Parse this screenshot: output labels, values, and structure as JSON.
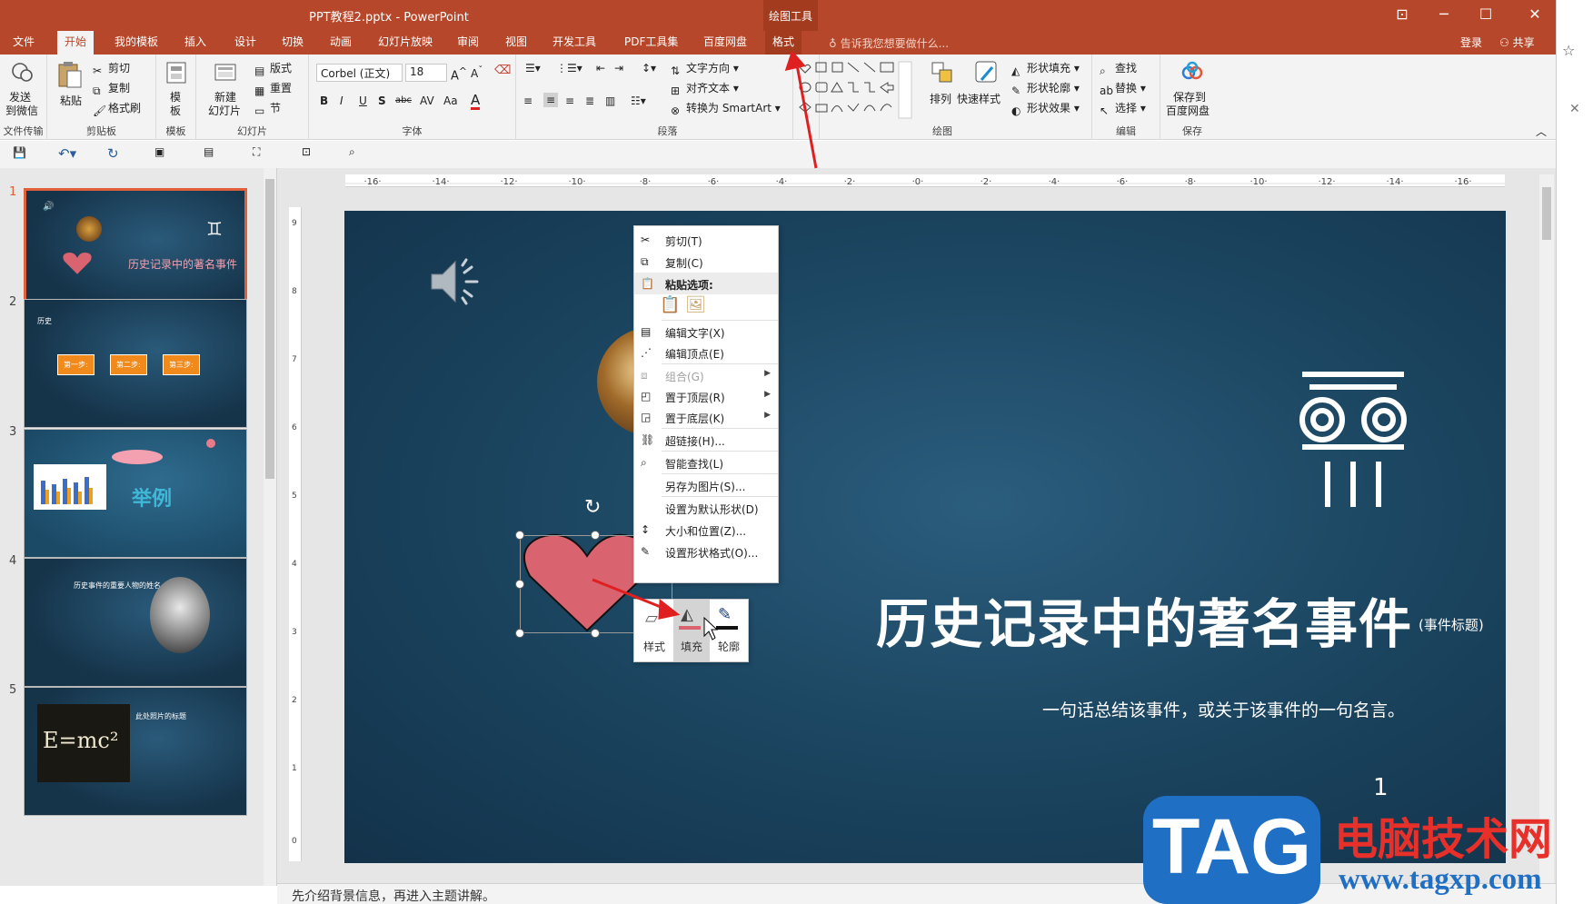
{
  "window": {
    "title": "PPT教程2.pptx - PowerPoint",
    "context_tool": "绘图工具",
    "controls": [
      "⊡",
      "─",
      "☐",
      "✕"
    ]
  },
  "tabs": [
    "文件",
    "开始",
    "我的模板",
    "插入",
    "设计",
    "切换",
    "动画",
    "幻灯片放映",
    "审阅",
    "视图",
    "开发工具",
    "PDF工具集",
    "百度网盘",
    "格式"
  ],
  "active_tab": "开始",
  "tell_me": "告诉我您想要做什么...",
  "account": {
    "login": "登录",
    "share": "共享"
  },
  "ribbon": {
    "send": {
      "label1": "发送",
      "label2": "到微信",
      "group": "文件传输"
    },
    "clipboard": {
      "paste": "粘贴",
      "cut": "剪切",
      "copy": "复制",
      "format_painter": "格式刷",
      "group": "剪贴板"
    },
    "template": {
      "label1": "模",
      "label2": "板",
      "group": "模板"
    },
    "slides": {
      "new1": "新建",
      "new2": "幻灯片",
      "layout": "版式",
      "reset": "重置",
      "section": "节",
      "group": "幻灯片"
    },
    "font": {
      "name": "Corbel (正文)",
      "size": "18",
      "group": "字体"
    },
    "paragraph": {
      "text_direction": "文字方向",
      "align_text": "对齐文本",
      "smartart": "转换为 SmartArt",
      "group": "段落"
    },
    "drawing": {
      "arrange": "排列",
      "quick_styles": "快速样式",
      "fill": "形状填充",
      "outline": "形状轮廓",
      "effects": "形状效果",
      "group": "绘图"
    },
    "editing": {
      "find": "查找",
      "replace": "替换",
      "select": "选择",
      "group": "编辑"
    },
    "save": {
      "label1": "保存到",
      "label2": "百度网盘",
      "group": "保存"
    }
  },
  "thumbnails": [
    {
      "num": "1",
      "title": "历史记录中的著名事件"
    },
    {
      "num": "2",
      "title": "历史",
      "steps": [
        "第一步:",
        "第二步:",
        "第三步:"
      ]
    },
    {
      "num": "3",
      "title": "举例"
    },
    {
      "num": "4",
      "title": "历史事件的重要人物的姓名"
    },
    {
      "num": "5",
      "title": "此处照片的标题"
    }
  ],
  "slide": {
    "title": "历史记录中的著名事件",
    "title_note": "(事件标题)",
    "quote": "一句话总结该事件，或关于该事件的一句名言。",
    "number": "1",
    "heart_color": "#d9636e"
  },
  "context_menu": {
    "items": [
      {
        "label": "剪切(T)",
        "icon": "scissors-icon",
        "enabled": true
      },
      {
        "label": "复制(C)",
        "icon": "copy-icon",
        "enabled": true
      },
      {
        "label": "粘贴选项:",
        "icon": "paste-icon",
        "enabled": true,
        "header": true
      },
      {
        "label": "编辑文字(X)",
        "icon": "edit-text-icon",
        "enabled": true
      },
      {
        "label": "编辑顶点(E)",
        "icon": "edit-points-icon",
        "enabled": true
      },
      {
        "label": "组合(G)",
        "icon": "group-icon",
        "enabled": false,
        "submenu": true
      },
      {
        "label": "置于顶层(R)",
        "icon": "bring-front-icon",
        "enabled": true,
        "submenu": true
      },
      {
        "label": "置于底层(K)",
        "icon": "send-back-icon",
        "enabled": true,
        "submenu": true
      },
      {
        "label": "超链接(H)...",
        "icon": "hyperlink-icon",
        "enabled": true
      },
      {
        "label": "智能查找(L)",
        "icon": "smart-lookup-icon",
        "enabled": true
      },
      {
        "label": "另存为图片(S)...",
        "icon": "",
        "enabled": true
      },
      {
        "label": "设置为默认形状(D)",
        "icon": "",
        "enabled": true
      },
      {
        "label": "大小和位置(Z)...",
        "icon": "size-icon",
        "enabled": true
      },
      {
        "label": "设置形状格式(O)...",
        "icon": "format-shape-icon",
        "enabled": true
      }
    ]
  },
  "mini_toolbar": {
    "style": "样式",
    "fill": "填充",
    "outline": "轮廓"
  },
  "notes": "先介绍背景信息，再进入主题讲解。",
  "watermark": {
    "tag": "TAG",
    "site_name": "电脑技术网",
    "url": "www.tagxp.com"
  },
  "colors": {
    "brand": "#b7472a",
    "accent_selected": "#e0603a",
    "slide_bg": "#1b4560"
  }
}
